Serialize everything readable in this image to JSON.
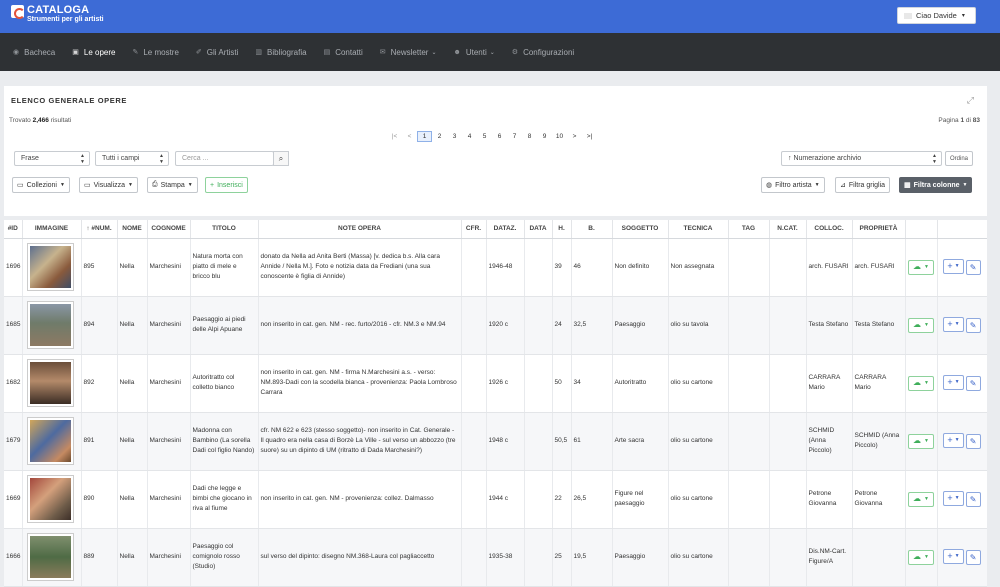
{
  "app": {
    "logo_title": "CATALOGA",
    "logo_subtitle": "Strumenti per gli artisti",
    "user_label": "Ciao Davide"
  },
  "nav": [
    {
      "label": "Bacheca",
      "icon": "palette-icon"
    },
    {
      "label": "Le opere",
      "icon": "image-icon"
    },
    {
      "label": "Le mostre",
      "icon": "brush-icon"
    },
    {
      "label": "Gli Artisti",
      "icon": "paint-icon"
    },
    {
      "label": "Bibliografia",
      "icon": "library-icon"
    },
    {
      "label": "Contatti",
      "icon": "address-icon"
    },
    {
      "label": "Newsletter",
      "icon": "envelope-icon"
    },
    {
      "label": "Utenti",
      "icon": "users-icon"
    },
    {
      "label": "Configurazioni",
      "icon": "gears-icon"
    }
  ],
  "panel": {
    "title": "ELENCO GENERALE OPERE",
    "found_prefix": "Trovato",
    "found_count": "2,466",
    "found_suffix": "risultati",
    "page_prefix": "Pagina",
    "page_current": "1",
    "page_mid": "di",
    "page_total": "83"
  },
  "pager": [
    "|<",
    "<",
    "1",
    "2",
    "3",
    "4",
    "5",
    "6",
    "7",
    "8",
    "9",
    "10",
    ">",
    ">|"
  ],
  "filters": {
    "field1": "Frase",
    "field2": "Tutti i campi",
    "search_placeholder": "Cerca ...",
    "sort_select": "↑ Numerazione archivio",
    "order_btn": "Ordina"
  },
  "toolbar": {
    "collezioni": "Collezioni",
    "visualizza": "Visualizza",
    "stampa": "Stampa",
    "inserisci": "Inserisci",
    "filtro_artista": "Filtro artista",
    "filtro_griglia": "Filtra griglia",
    "filtra_colonne": "Filtra colonne"
  },
  "columns": [
    "#ID",
    "IMMAGINE",
    "↑ #NUM.",
    "NOME",
    "COGNOME",
    "TITOLO",
    "NOTE OPERA",
    "CFR.",
    "DATAZ.",
    "DATA",
    "H.",
    "B.",
    "SOGGETTO",
    "TECNICA",
    "TAG",
    "N.CAT.",
    "COLLOC.",
    "PROPRIETÀ",
    "",
    ""
  ],
  "rows": [
    {
      "id": "1696",
      "num": "895",
      "nome": "Nella",
      "cognome": "Marchesini",
      "titolo": "Natura morta con piatto di mele e bricco blu",
      "note": "donato da Nella ad Anita Berti (Massa) [v. dedica b.s. Alla cara Annide / Nella M.]. Foto e notizia data da Frediani (una sua conoscente è figlia di Annide)",
      "cfr": "",
      "dataz": "1946-48",
      "data": "",
      "h": "39",
      "b": "46",
      "soggetto": "Non definito",
      "tecnica": "Non assegnata",
      "tag": "",
      "ncat": "",
      "colloc": "arch. FUSARI",
      "proprieta": "arch. FUSARI"
    },
    {
      "id": "1685",
      "num": "894",
      "nome": "Nella",
      "cognome": "Marchesini",
      "titolo": "Paesaggio ai piedi delle Alpi Apuane",
      "note": "non inserito in cat. gen. NM - rec. furto/2016 - cfr. NM.3 e NM.94",
      "cfr": "",
      "dataz": "1920 c",
      "data": "",
      "h": "24",
      "b": "32,5",
      "soggetto": "Paesaggio",
      "tecnica": "olio su tavola",
      "tag": "",
      "ncat": "",
      "colloc": "Testa Stefano",
      "proprieta": "Testa Stefano"
    },
    {
      "id": "1682",
      "num": "892",
      "nome": "Nella",
      "cognome": "Marchesini",
      "titolo": "Autoritratto col colletto bianco",
      "note": "non inserito in cat. gen. NM - firma N.Marchesini a.s. - verso: NM.893-Dadi con la scodella bianca - provenienza: Paola Lombroso Carrara",
      "cfr": "",
      "dataz": "1926 c",
      "data": "",
      "h": "50",
      "b": "34",
      "soggetto": "Autoritratto",
      "tecnica": "olio su cartone",
      "tag": "",
      "ncat": "",
      "colloc": "CARRARA Mario",
      "proprieta": "CARRARA Mario"
    },
    {
      "id": "1679",
      "num": "891",
      "nome": "Nella",
      "cognome": "Marchesini",
      "titolo": "Madonna con Bambino (La sorella Dadi col figlio Nando)",
      "note": "cfr. NM 622 e 623 (stesso soggetto)- non inserito in Cat. Generale - Il quadro era nella casa di Borzè La Ville - sul verso un abbozzo (tre suore) su un dipinto di UM (ritratto di Dada Marchesini?)",
      "cfr": "",
      "dataz": "1948 c",
      "data": "",
      "h": "50,5",
      "b": "61",
      "soggetto": "Arte sacra",
      "tecnica": "olio su cartone",
      "tag": "",
      "ncat": "",
      "colloc": "SCHMID (Anna Piccolo)",
      "proprieta": "SCHMID (Anna Piccolo)"
    },
    {
      "id": "1669",
      "num": "890",
      "nome": "Nella",
      "cognome": "Marchesini",
      "titolo": "Dadi che legge e bimbi che giocano in riva al fiume",
      "note": "non inserito in cat. gen. NM - provenienza: collez. Dalmasso",
      "cfr": "",
      "dataz": "1944 c",
      "data": "",
      "h": "22",
      "b": "26,5",
      "soggetto": "Figure nel paesaggio",
      "tecnica": "olio su cartone",
      "tag": "",
      "ncat": "",
      "colloc": "Petrone Giovanna",
      "proprieta": "Petrone Giovanna"
    },
    {
      "id": "1666",
      "num": "889",
      "nome": "Nella",
      "cognome": "Marchesini",
      "titolo": "Paesaggio col comignolo rosso (Studio)",
      "note": "sul verso del dipinto: disegno NM.368-Laura col pagliaccetto",
      "cfr": "",
      "dataz": "1935-38",
      "data": "",
      "h": "25",
      "b": "19,5",
      "soggetto": "Paesaggio",
      "tecnica": "olio su cartone",
      "tag": "",
      "ncat": "",
      "colloc": "Dis.NM-Cart. Figure/A",
      "proprieta": ""
    }
  ]
}
